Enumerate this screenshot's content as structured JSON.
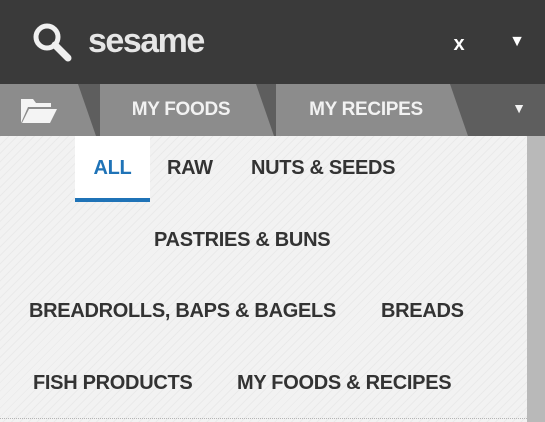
{
  "search": {
    "query": "sesame",
    "clear_label": "x",
    "menu_icon": "chevron-down-icon",
    "icon": "search-icon"
  },
  "tabs": {
    "folder_icon": "folder-open-icon",
    "items": [
      {
        "label": "MY FOODS"
      },
      {
        "label": "MY RECIPES"
      }
    ],
    "more_icon": "chevron-down-icon"
  },
  "categories": {
    "active": "ALL",
    "items": [
      {
        "label": "ALL"
      },
      {
        "label": "RAW"
      },
      {
        "label": "NUTS & SEEDS"
      },
      {
        "label": "PASTRIES & BUNS"
      },
      {
        "label": "BREADROLLS, BAPS & BAGELS"
      },
      {
        "label": "BREADS"
      },
      {
        "label": "FISH PRODUCTS"
      },
      {
        "label": "MY FOODS & RECIPES"
      }
    ]
  },
  "colors": {
    "topbar": "#3a3a3a",
    "tabbar": "#5e5e5e",
    "tab": "#8c8c8c",
    "accent": "#1f73b7",
    "text": "#333333"
  }
}
